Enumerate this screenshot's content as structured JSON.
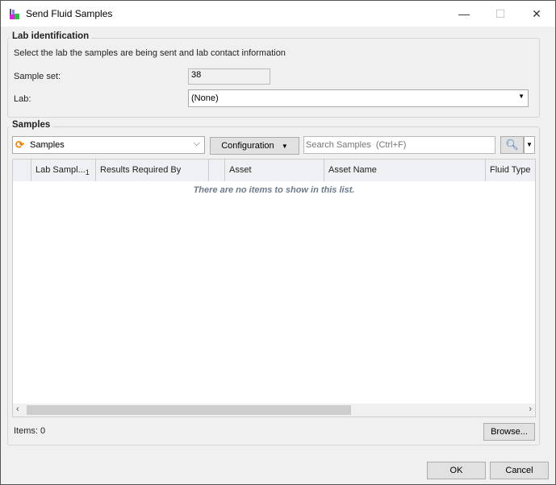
{
  "window": {
    "title": "Send Fluid Samples",
    "minimize": "—",
    "maximize": "☐",
    "close": "✕"
  },
  "lab_identification": {
    "title": "Lab identification",
    "description": "Select the lab the samples are being sent and lab contact information",
    "sample_set_label": "Sample set:",
    "sample_set_value": "38",
    "lab_label": "Lab:",
    "lab_value": "(None)"
  },
  "samples": {
    "title": "Samples",
    "view_select": "Samples",
    "configuration_label": "Configuration",
    "search_placeholder": "Search Samples  (Ctrl+F)",
    "columns": [
      "",
      "Lab Sampl...",
      "Results Required By",
      "",
      "Asset",
      "Asset Name",
      "Fluid Type"
    ],
    "sort_indicator": "1",
    "empty_message": "There are no items to show in this list.",
    "items_label": "Items: 0",
    "browse_label": "Browse..."
  },
  "footer": {
    "ok_label": "OK",
    "cancel_label": "Cancel"
  }
}
